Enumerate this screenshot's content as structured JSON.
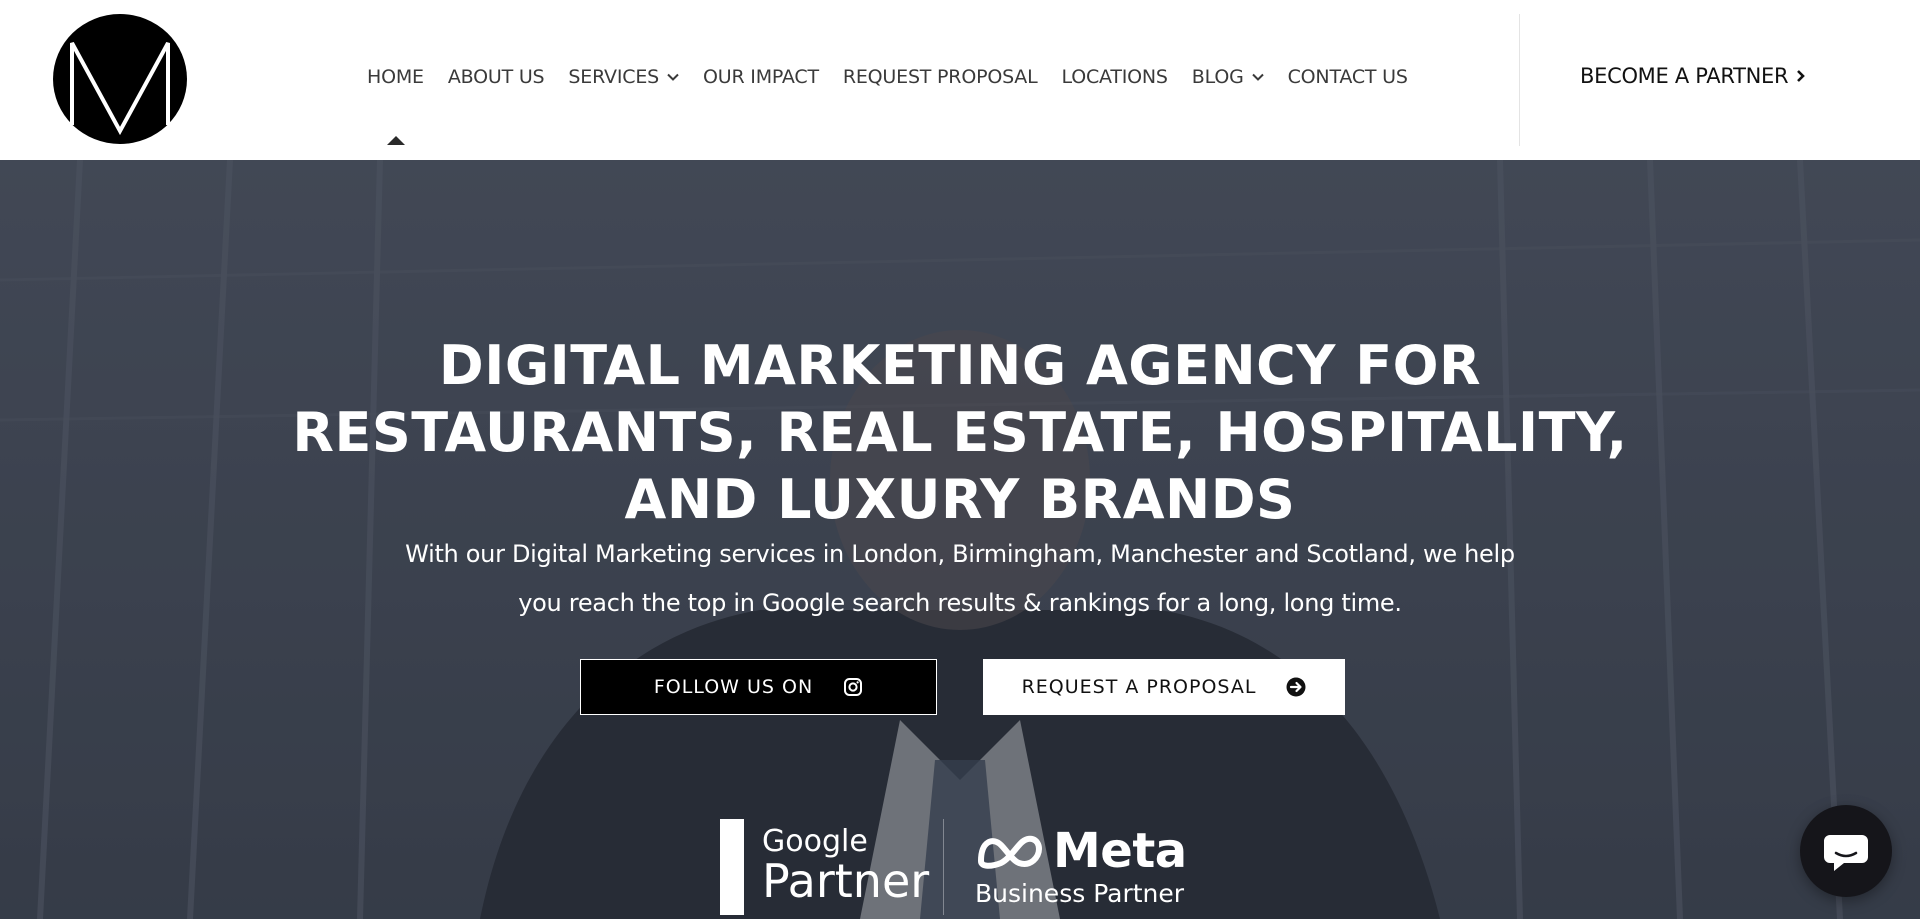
{
  "logo": {
    "letter": "M",
    "icon": "m-monogram-logo"
  },
  "nav": {
    "items": [
      {
        "label": "HOME",
        "active": true
      },
      {
        "label": "ABOUT US"
      },
      {
        "label": "SERVICES",
        "dropdown": true
      },
      {
        "label": "OUR IMPACT"
      },
      {
        "label": "REQUEST PROPOSAL"
      },
      {
        "label": "LOCATIONS"
      },
      {
        "label": "BLOG",
        "dropdown": true
      },
      {
        "label": "CONTACT US"
      }
    ],
    "cta": {
      "label": "BECOME A PARTNER",
      "icon": "chevron-right-icon"
    }
  },
  "hero": {
    "title_lines": [
      "DIGITAL MARKETING AGENCY FOR",
      "RESTAURANTS, REAL ESTATE, HOSPITALITY,",
      "AND LUXURY BRANDS"
    ],
    "subtitle_lines": [
      "With our Digital Marketing services in London, Birmingham, Manchester and Scotland, we help",
      "you reach the top in Google search results & rankings for a long, long time."
    ],
    "buttons": {
      "follow": {
        "label": "FOLLOW US ON",
        "icon": "instagram-icon"
      },
      "proposal": {
        "label": "REQUEST A PROPOSAL",
        "icon": "arrow-circle-right-icon"
      }
    }
  },
  "badges": {
    "google": {
      "line1": "Google",
      "line2": "Partner"
    },
    "meta": {
      "line1": "Meta",
      "line2": "Business Partner",
      "icon": "meta-infinity-icon"
    }
  },
  "chat": {
    "icon": "chat-bubble-icon"
  },
  "colors": {
    "nav_text": "#3a3a3a",
    "hero_overlay": "#454c58",
    "button_dark": "#000000",
    "button_light": "#ffffff"
  }
}
